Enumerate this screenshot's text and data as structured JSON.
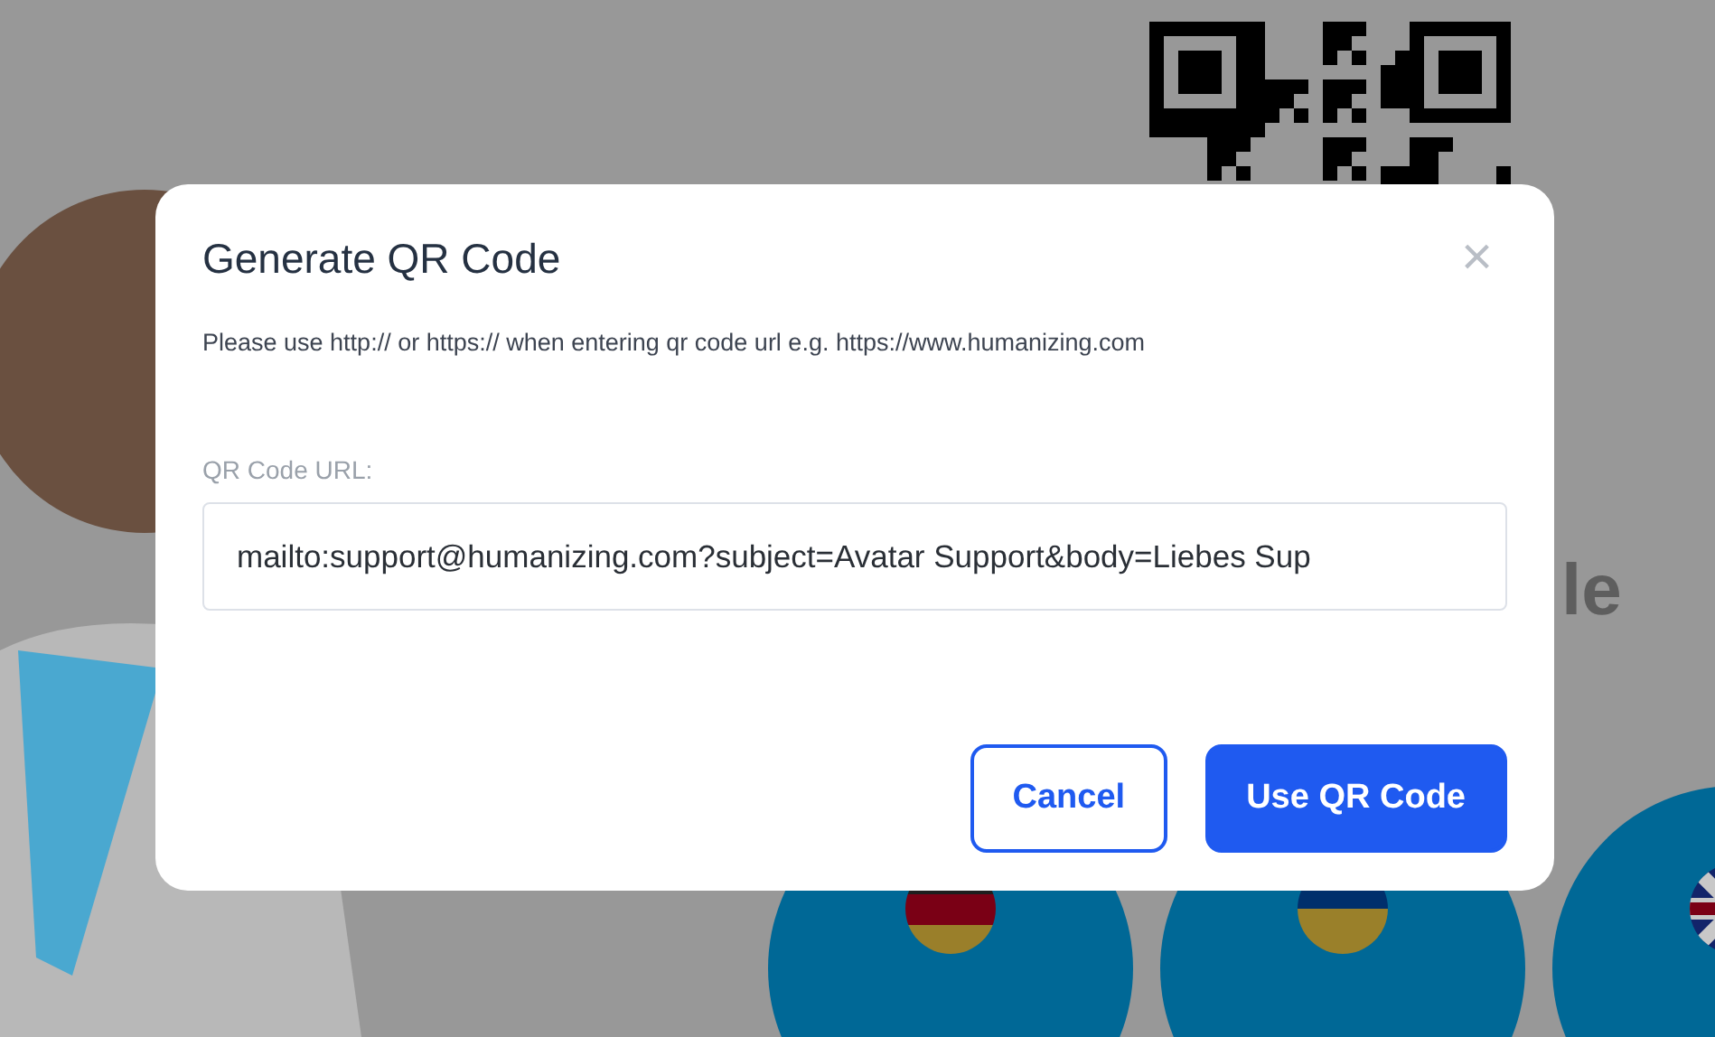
{
  "background": {
    "heading": "le",
    "languages": [
      {
        "kind": "germany"
      },
      {
        "kind": "ukraine"
      },
      {
        "kind": "uk"
      }
    ]
  },
  "dialog": {
    "title": "Generate QR Code",
    "close": "×",
    "hint": "Please use http:// or https:// when entering qr code url e.g. https://www.humanizing.com",
    "field": {
      "label": "QR Code URL:",
      "value": "mailto:support@humanizing.com?subject=Avatar Support&body=Liebes Sup"
    },
    "buttons": [
      {
        "label": "Cancel",
        "kind": "secondary"
      },
      {
        "label": "Use QR Code",
        "kind": "primary"
      }
    ]
  }
}
